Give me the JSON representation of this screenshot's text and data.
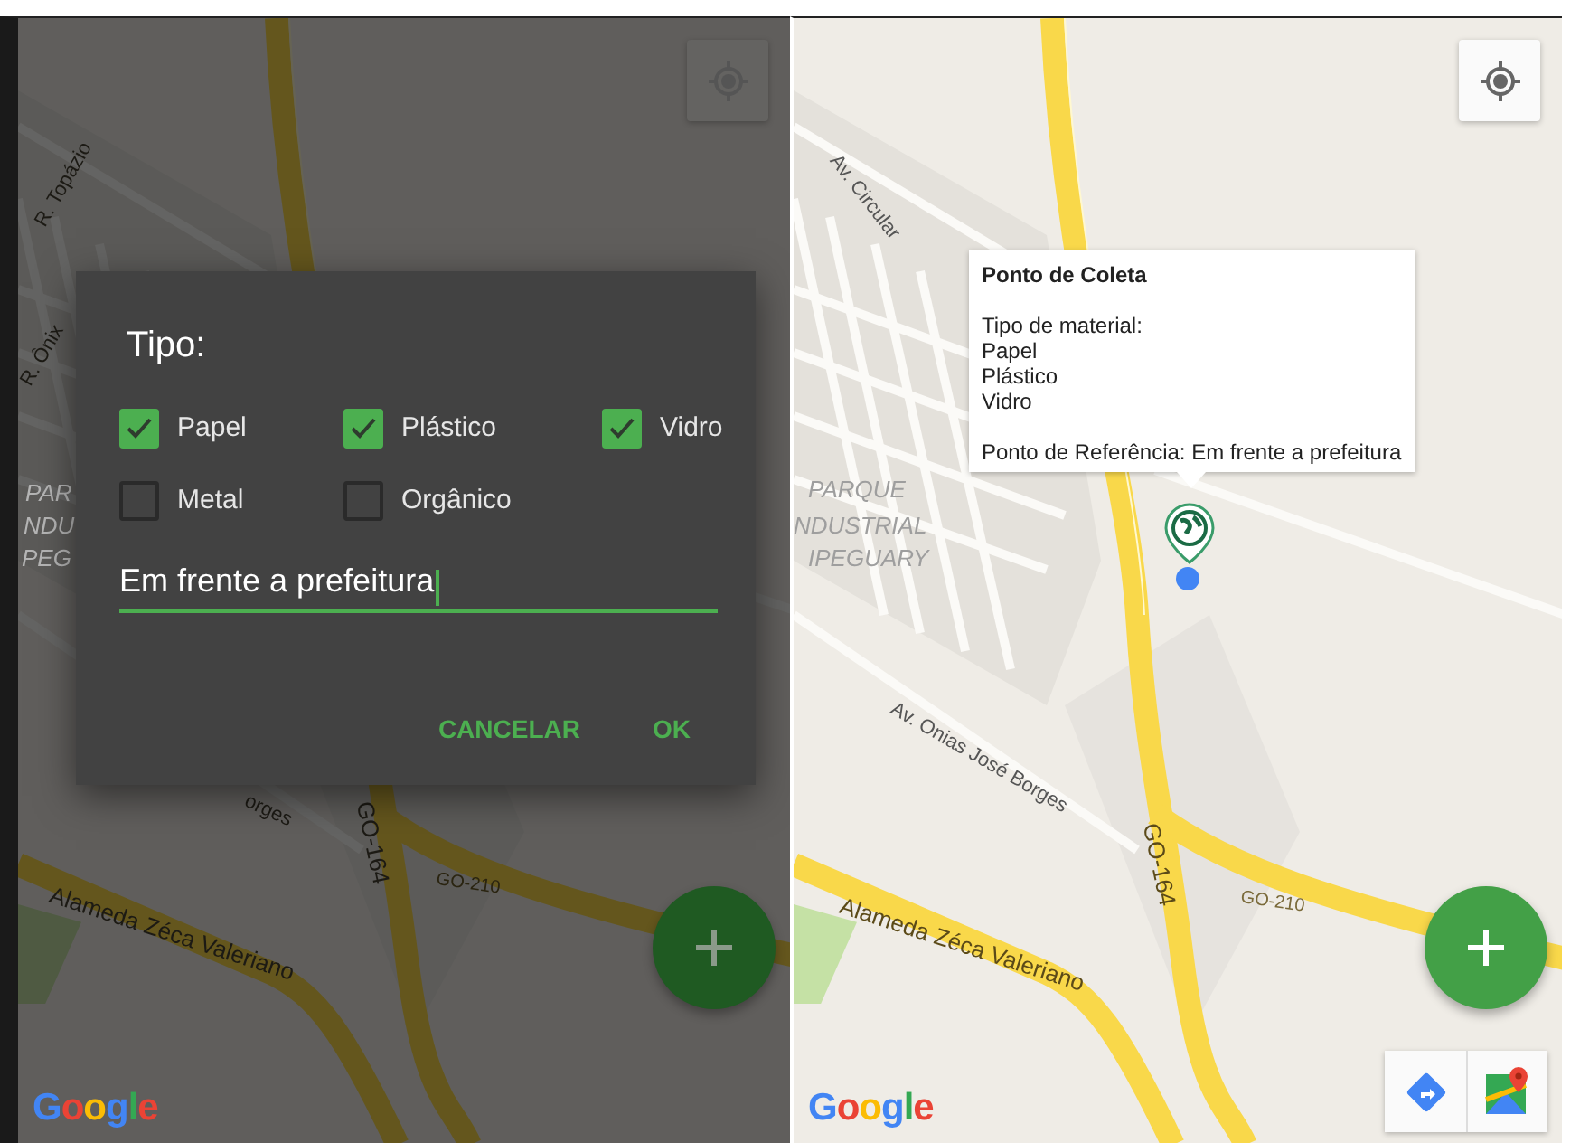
{
  "screens": [
    {
      "map": {
        "labels": [
          {
            "text": "R. Topázio",
            "kind": "road"
          },
          {
            "text": "R. Ônix",
            "kind": "road"
          },
          {
            "text": "PAR",
            "kind": "area"
          },
          {
            "text": "NDU",
            "kind": "area"
          },
          {
            "text": "PEG",
            "kind": "area"
          },
          {
            "text": "orges",
            "kind": "road"
          },
          {
            "text": "GO-164",
            "kind": "highway"
          },
          {
            "text": "GO-210",
            "kind": "route"
          },
          {
            "text": "Alameda Zéca Valeriano",
            "kind": "highway"
          }
        ],
        "logo": "Google"
      },
      "dialog": {
        "title": "Tipo:",
        "options": [
          {
            "label": "Papel",
            "checked": true
          },
          {
            "label": "Plástico",
            "checked": true
          },
          {
            "label": "Vidro",
            "checked": true
          },
          {
            "label": "Metal",
            "checked": false
          },
          {
            "label": "Orgânico",
            "checked": false
          }
        ],
        "reference_field": {
          "value": "Em frente a prefeitura",
          "focused": true
        },
        "buttons": [
          "CANCELAR",
          "OK"
        ]
      }
    },
    {
      "map": {
        "labels": [
          {
            "text": "Av. Circular",
            "kind": "road"
          },
          {
            "text": "PARQUE",
            "kind": "area"
          },
          {
            "text": "NDUSTRIAL",
            "kind": "area"
          },
          {
            "text": "IPEGUARY",
            "kind": "area"
          },
          {
            "text": "Av. Onias José Borges",
            "kind": "road"
          },
          {
            "text": "GO-164",
            "kind": "highway"
          },
          {
            "text": "GO-210",
            "kind": "route"
          },
          {
            "text": "Alameda Zéca Valeriano",
            "kind": "highway"
          }
        ],
        "logo": "Google"
      },
      "info_window": {
        "title": "Ponto de Coleta",
        "lines": [
          "Tipo de material:",
          "Papel",
          "Plástico",
          "Vidro"
        ],
        "reference": "Ponto de Referência: Em frente a prefeitura"
      },
      "map_toolbar": true
    }
  ]
}
